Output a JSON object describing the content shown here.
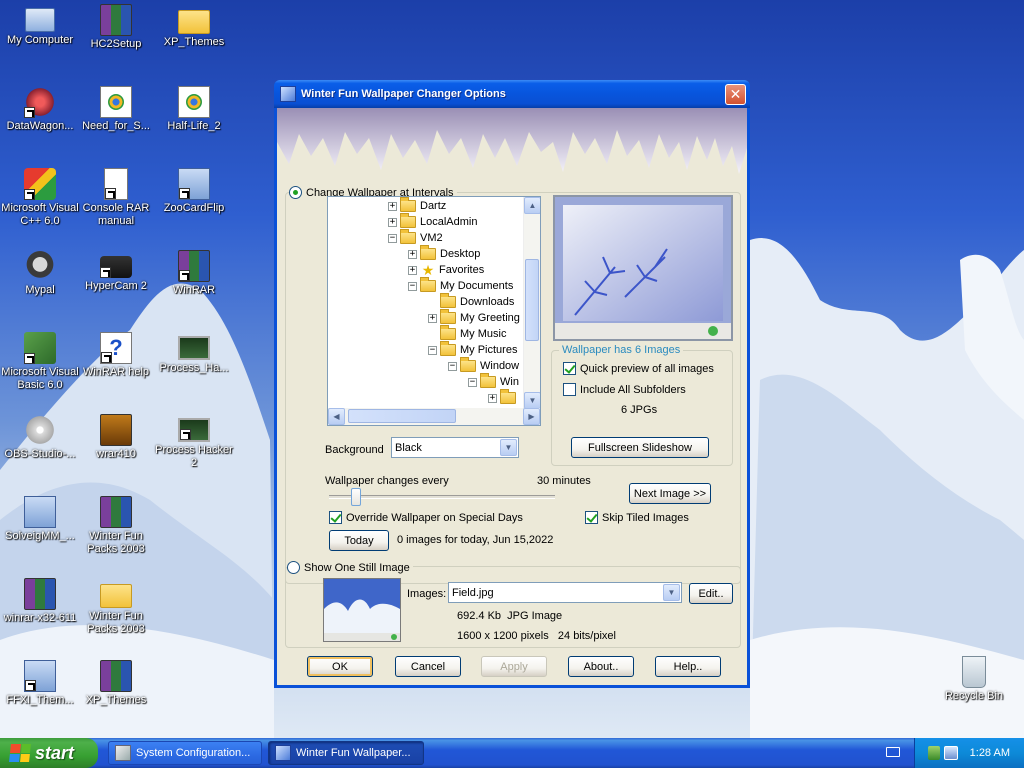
{
  "desktop": {
    "icons": [
      {
        "label": "My Computer"
      },
      {
        "label": "HC2Setup"
      },
      {
        "label": "XP_Themes"
      },
      {
        "label": "DataWagon..."
      },
      {
        "label": "Need_for_S..."
      },
      {
        "label": "Half-Life_2"
      },
      {
        "label": "Microsoft Visual C++ 6.0"
      },
      {
        "label": "Console RAR manual"
      },
      {
        "label": "ZooCardFlip"
      },
      {
        "label": "Mypal"
      },
      {
        "label": "HyperCam 2"
      },
      {
        "label": "WinRAR"
      },
      {
        "label": "Microsoft Visual Basic 6.0"
      },
      {
        "label": "WinRAR help"
      },
      {
        "label": "Process_Ha..."
      },
      {
        "label": "OBS-Studio-..."
      },
      {
        "label": "wrar410"
      },
      {
        "label": "Process Hacker 2"
      },
      {
        "label": "SolveigMM_..."
      },
      {
        "label": "Winter Fun Packs 2003"
      },
      {
        "label": "winrar-x32-611"
      },
      {
        "label": "Winter Fun Packs 2003"
      },
      {
        "label": "FFXI_Them..."
      },
      {
        "label": "XP_Themes"
      },
      {
        "label": "Recycle Bin"
      }
    ]
  },
  "window": {
    "title": "Winter Fun Wallpaper Changer Options",
    "intervals_label": "Change Wallpaper at Intervals",
    "tree": [
      {
        "label": "Dartz",
        "expander": "+",
        "icon": "folder"
      },
      {
        "label": "LocalAdmin",
        "expander": "+",
        "icon": "folder"
      },
      {
        "label": "VM2",
        "expander": "−",
        "icon": "folder"
      },
      {
        "label": "Desktop",
        "expander": "+",
        "icon": "folder"
      },
      {
        "label": "Favorites",
        "expander": "+",
        "icon": "star"
      },
      {
        "label": "My Documents",
        "expander": "−",
        "icon": "folder"
      },
      {
        "label": "Downloads",
        "expander": "",
        "icon": "folder"
      },
      {
        "label": "My Greeting",
        "expander": "+",
        "icon": "folder"
      },
      {
        "label": "My Music",
        "expander": "",
        "icon": "folder"
      },
      {
        "label": "My Pictures",
        "expander": "−",
        "icon": "folder"
      },
      {
        "label": "Window",
        "expander": "−",
        "icon": "folder"
      },
      {
        "label": "Win",
        "expander": "−",
        "icon": "folder"
      },
      {
        "label": "",
        "expander": "+",
        "icon": "folder"
      }
    ],
    "info_group_title": "Wallpaper has 6 Images",
    "quick_preview_label": "Quick preview of all images",
    "include_subfolders_label": "Include All Subfolders",
    "jpg_count": "6 JPGs",
    "fullscreen_label": "Fullscreen Slideshow",
    "background_label": "Background",
    "background_value": "Black",
    "changes_every_label": "Wallpaper changes every",
    "interval_value": "30 minutes",
    "interval_slider_fraction": 0.12,
    "next_image_label": "Next Image >>",
    "override_label": "Override Wallpaper on Special Days",
    "skip_tiled_label": "Skip Tiled Images",
    "today_label": "Today",
    "today_info": "0 images for today, Jun 15,2022",
    "still_label": "Show One Still Image",
    "images_label": "Images:",
    "images_value": "Field.jpg",
    "edit_label": "Edit..",
    "file_size": "692.4 Kb  JPG Image",
    "file_dims": "1600 x 1200 pixels   24 bits/pixel",
    "ok_label": "OK",
    "cancel_label": "Cancel",
    "apply_label": "Apply",
    "about_label": "About..",
    "help_label": "Help.."
  },
  "taskbar": {
    "start_label": "start",
    "tasks": [
      {
        "label": "System Configuration..."
      },
      {
        "label": "Winter Fun Wallpaper..."
      }
    ],
    "clock": "1:28 AM"
  }
}
